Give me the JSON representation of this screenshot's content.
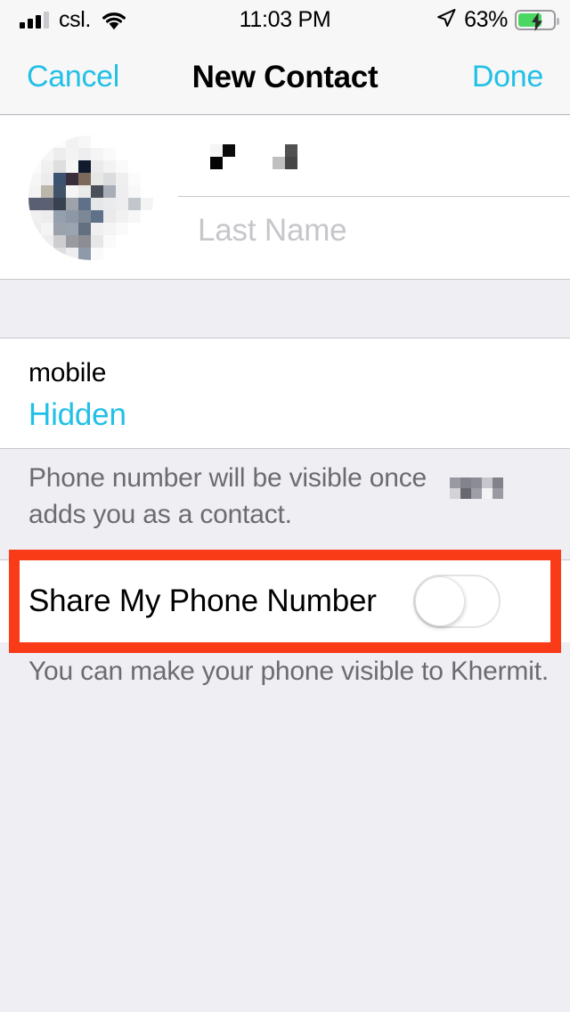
{
  "status_bar": {
    "carrier": "csl.",
    "time": "11:03 PM",
    "battery_percent": "63%",
    "battery_level": 63,
    "signal_bars_filled": 3,
    "signal_bars_total": 4,
    "wifi_icon": "wifi-icon",
    "location_icon": "location-arrow-icon",
    "battery_icon": "battery-charging-icon"
  },
  "nav_bar": {
    "cancel_label": "Cancel",
    "title": "New Contact",
    "done_label": "Done",
    "tint_color": "#22c0e6"
  },
  "name_section": {
    "avatar_name": "contact-avatar",
    "avatar_state": "pixelated-redacted",
    "first_name_value": "",
    "first_name_state": "pixelated-redacted",
    "first_name_placeholder": "First Name",
    "last_name_value": "",
    "last_name_placeholder": "Last Name"
  },
  "phone_section": {
    "label": "mobile",
    "value": "Hidden",
    "value_color": "#22c0e6"
  },
  "note_1": {
    "text_before": "Phone number will be visible once",
    "redacted_name_state": "pixelated-redacted",
    "text_after": "adds you as a contact."
  },
  "toggle_row": {
    "label": "Share My Phone Number",
    "toggle_state": "off",
    "highlight_color": "#f93b17",
    "highlighted": true
  },
  "note_2": {
    "text": "You can make your phone visible to Khermit."
  }
}
